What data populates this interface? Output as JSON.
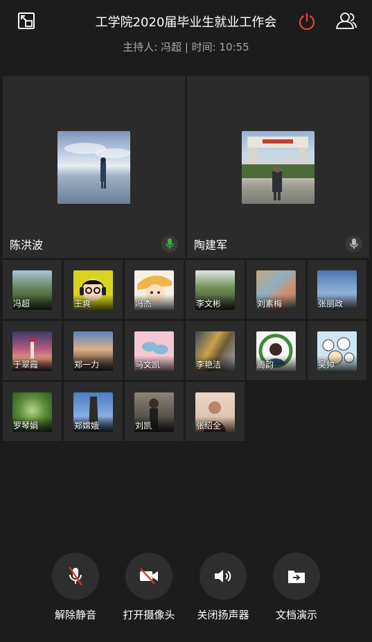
{
  "header": {
    "title": "工学院2020届毕业生就业工作会",
    "subtitle": "主持人: 冯超 | 时间: 10:55",
    "accent_power": "#e5443b"
  },
  "main_speakers": [
    {
      "name": "陈洪波",
      "mic": "active",
      "mic_color": "#2fb344"
    },
    {
      "name": "陶建军",
      "mic": "idle",
      "mic_color": "#b8b8b8"
    }
  ],
  "participants": [
    {
      "name": "冯超"
    },
    {
      "name": "王爽"
    },
    {
      "name": "冯杰"
    },
    {
      "name": "李文彬"
    },
    {
      "name": "刘素梅"
    },
    {
      "name": "张丽政"
    },
    {
      "name": "于翠霞"
    },
    {
      "name": "郑一力"
    },
    {
      "name": "马文凯"
    },
    {
      "name": "李艳洁"
    },
    {
      "name": "周韵"
    },
    {
      "name": "吴帅"
    },
    {
      "name": "罗琴娟"
    },
    {
      "name": "郑嫦娥"
    },
    {
      "name": "刘凯"
    },
    {
      "name": "张绍全"
    }
  ],
  "controls": [
    {
      "label": "解除静音",
      "icon": "mic-muted-icon"
    },
    {
      "label": "打开摄像头",
      "icon": "camera-off-icon"
    },
    {
      "label": "关闭扬声器",
      "icon": "speaker-icon"
    },
    {
      "label": "文档演示",
      "icon": "folder-share-icon"
    }
  ]
}
